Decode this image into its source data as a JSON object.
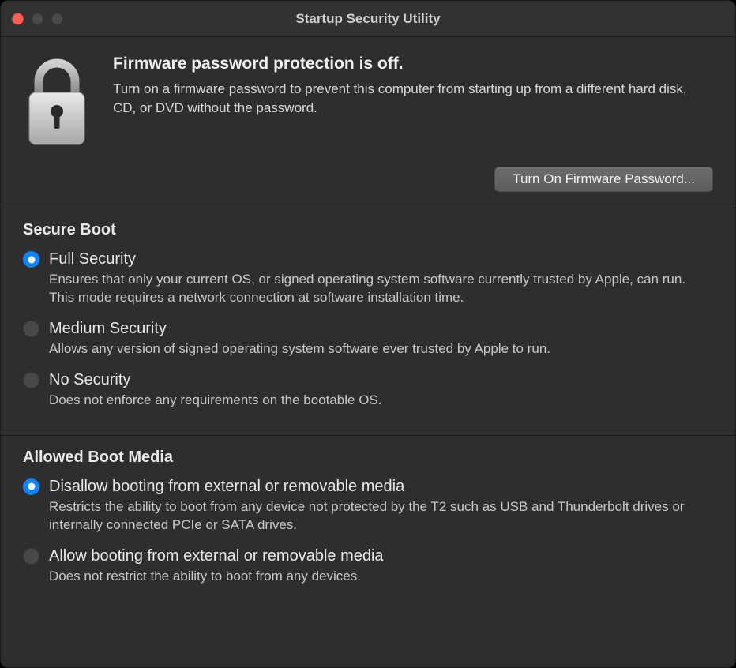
{
  "window": {
    "title": "Startup Security Utility"
  },
  "header": {
    "heading": "Firmware password protection is off.",
    "description": "Turn on a firmware password to prevent this computer from starting up from a different hard disk, CD, or DVD without the password.",
    "button_label": "Turn On Firmware Password..."
  },
  "secure_boot": {
    "title": "Secure Boot",
    "options": [
      {
        "label": "Full Security",
        "description": "Ensures that only your current OS, or signed operating system software currently trusted by Apple, can run. This mode requires a network connection at software installation time.",
        "selected": true
      },
      {
        "label": "Medium Security",
        "description": "Allows any version of signed operating system software ever trusted by Apple to run.",
        "selected": false
      },
      {
        "label": "No Security",
        "description": "Does not enforce any requirements on the bootable OS.",
        "selected": false
      }
    ]
  },
  "allowed_boot_media": {
    "title": "Allowed Boot Media",
    "options": [
      {
        "label": "Disallow booting from external or removable media",
        "description": "Restricts the ability to boot from any device not protected by the T2 such as USB and Thunderbolt drives or internally connected PCIe or SATA drives.",
        "selected": true
      },
      {
        "label": "Allow booting from external or removable media",
        "description": "Does not restrict the ability to boot from any devices.",
        "selected": false
      }
    ]
  }
}
